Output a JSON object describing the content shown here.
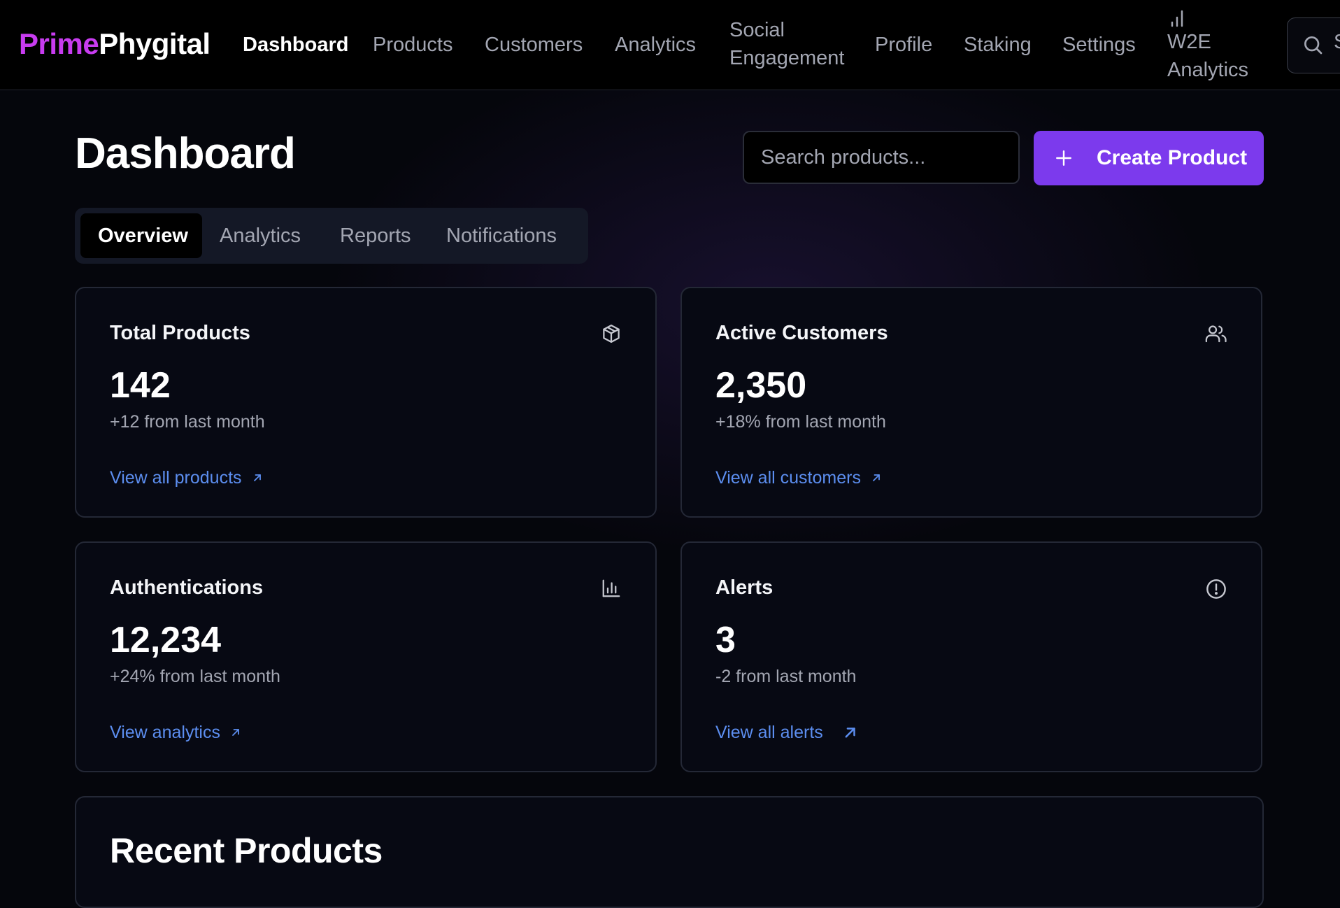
{
  "brand": {
    "part1": "Prime",
    "part2": "Phygital"
  },
  "nav": {
    "dashboard": "Dashboard",
    "products": "Products",
    "customers": "Customers",
    "analytics": "Analytics",
    "social_line1": "Social",
    "social_line2": "Engagement",
    "profile": "Profile",
    "staking": "Staking",
    "settings": "Settings",
    "w2e_line1": "W2E",
    "w2e_line2": "Analytics",
    "search_label": "S"
  },
  "header": {
    "title": "Dashboard",
    "search_placeholder": "Search products...",
    "create_label": "Create Product"
  },
  "tabs": [
    "Overview",
    "Analytics",
    "Reports",
    "Notifications"
  ],
  "cards": [
    {
      "title": "Total Products",
      "value": "142",
      "sub": "+12 from last month",
      "link": "View all products",
      "icon": "package-icon"
    },
    {
      "title": "Active Customers",
      "value": "2,350",
      "sub": "+18% from last month",
      "link": "View all customers",
      "icon": "users-icon"
    },
    {
      "title": "Authentications",
      "value": "12,234",
      "sub": "+24% from last month",
      "link": "View analytics",
      "icon": "bar-chart-icon"
    },
    {
      "title": "Alerts",
      "value": "3",
      "sub": "-2 from last month",
      "link": "View all alerts",
      "icon": "alert-circle-icon"
    }
  ],
  "recent": {
    "title": "Recent Products"
  },
  "colors": {
    "brand_accent": "#c83cf0",
    "primary_button": "#7c3aed",
    "link": "#5c8ef0",
    "background": "#05060c"
  }
}
